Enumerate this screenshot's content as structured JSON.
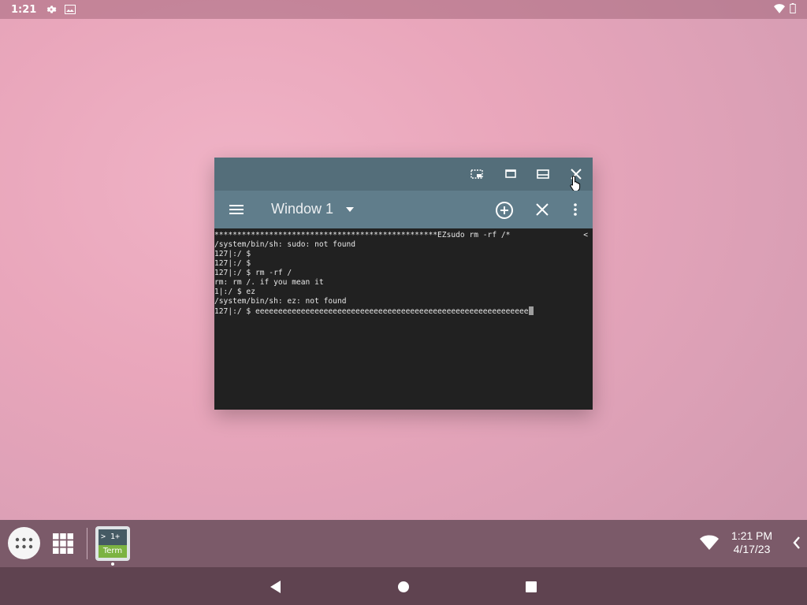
{
  "status_bar": {
    "time": "1:21",
    "icons": [
      "gear-icon",
      "image-icon",
      "wifi-icon",
      "battery-icon"
    ]
  },
  "window": {
    "caption_icons": [
      "pip-icon",
      "restore-icon",
      "maximize-icon",
      "close-icon"
    ],
    "toolbar": {
      "menu_icon": "hamburger-menu-icon",
      "title": "Window 1",
      "add_icon": "add-window-icon",
      "close_icon": "close-window-icon",
      "more_icon": "more-vert-icon"
    },
    "terminal": {
      "lines": [
        "*************************************************EZsudo rm -rf /*",
        "/system/bin/sh: sudo: not found",
        "127|:/ $",
        "127|:/ $",
        "127|:/ $ rm -rf /",
        "rm: rm /. if you mean it",
        "1|:/ $ ez",
        "/system/bin/sh: ez: not found",
        "127|:/ $ eeeeeeeeeeeeeeeeeeeeeeeeeeeeeeeeeeeeeeeeeeeeeeeeeeeeeeeeeeee"
      ],
      "scroll_indicator": "<",
      "background": "#212121"
    }
  },
  "taskbar": {
    "app_icon_top": "> 1+",
    "app_icon_bottom": "Term",
    "clock_time": "1:21 PM",
    "clock_date": "4/17/23"
  },
  "colors": {
    "caption_bar": "#546e7a",
    "toolbar": "#607d8b",
    "taskbar": "#7b5a69",
    "nav_bar": "#5f4350"
  }
}
